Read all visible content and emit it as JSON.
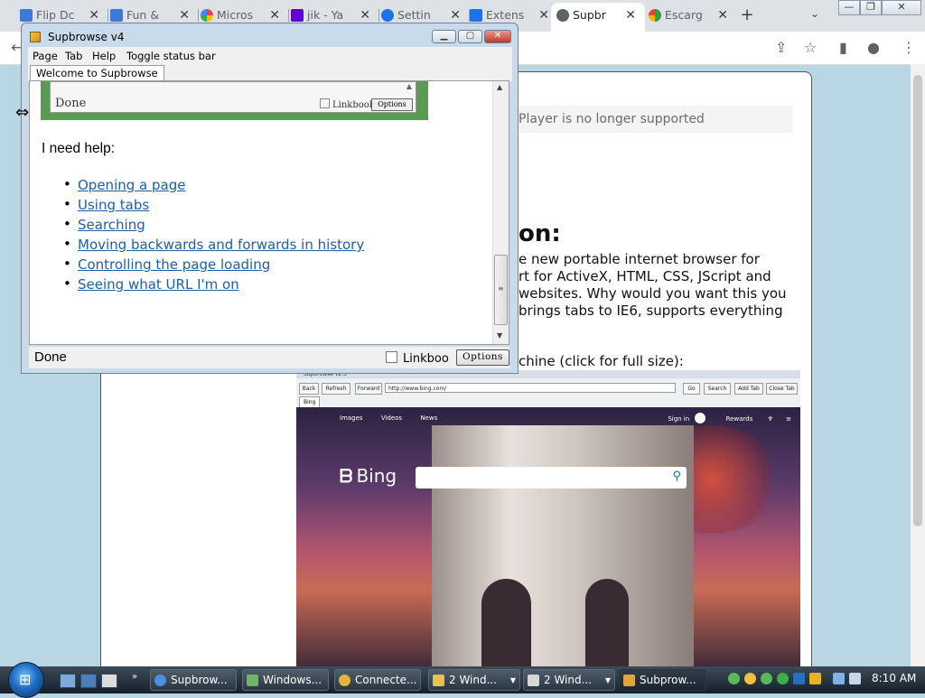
{
  "browser": {
    "tabs": [
      {
        "title": "Flip Dc",
        "favicon": "windows-flag-icon",
        "color": "#3b7bd6",
        "active": false
      },
      {
        "title": "Fun &",
        "favicon": "windows-flag-icon",
        "color": "#3b7bd6",
        "active": false
      },
      {
        "title": "Micros",
        "favicon": "google-icon",
        "color": "#e0553e",
        "active": false
      },
      {
        "title": "jik - Ya",
        "favicon": "yahoo-icon",
        "color": "#5f01d1",
        "active": false
      },
      {
        "title": "Settin",
        "favicon": "gear-icon",
        "color": "#1a73e8",
        "active": false
      },
      {
        "title": "Extens",
        "favicon": "puzzle-icon",
        "color": "#1a73e8",
        "active": false
      },
      {
        "title": "Supbr",
        "favicon": "globe-icon",
        "color": "#5f6368",
        "active": true
      },
      {
        "title": "Escarg",
        "favicon": "escargot-icon",
        "color": "#2e9e44",
        "active": false
      }
    ],
    "new_tab": "+",
    "tab_search": "⌄",
    "window_buttons": {
      "minimize": "—",
      "restore": "❐",
      "close": "✕"
    },
    "toolbar_icons": [
      "share-icon",
      "star-icon",
      "side-panel-icon",
      "profile-icon",
      "menu-icon"
    ]
  },
  "page": {
    "flash_notice": "Player is no longer supported",
    "heading": "on:",
    "paragraph_lines": [
      "e new portable internet browser for",
      "rt for ActiveX, HTML, CSS, JScript and",
      " websites. Why would you want this you",
      " brings tabs to IE6, supports everything"
    ],
    "screenshot_caption": "chine (click for full size):",
    "screenshot": {
      "window_title": "Supbrowse v2.5",
      "buttons": [
        "Back",
        "Refresh",
        "Forward",
        "Go",
        "Search",
        "Add Tab",
        "Close Tab"
      ],
      "url": "http://www.bing.com/",
      "tab": "Bing",
      "bing_nav": [
        "Images",
        "Videos",
        "News"
      ],
      "bing_signin": "Sign in",
      "bing_rewards": "Rewards",
      "bing_logo": "Bing"
    }
  },
  "supbrowse": {
    "title": "Supbrowse v4",
    "menu": [
      "Page",
      "Tab",
      "Help",
      "Toggle status bar"
    ],
    "tab_label": "Welcome to Supbrowse",
    "embedded": {
      "done": "Done",
      "linkbook": "Linkbook",
      "options": "Options"
    },
    "help_heading": "I need help:",
    "help_links": [
      "Opening a page",
      "Using tabs",
      "Searching",
      "Moving backwards and forwards in history",
      "Controlling the page loading",
      "Seeing what URL I'm on"
    ],
    "status": {
      "done": "Done",
      "linkbook": "Linkboo",
      "options": "Options"
    }
  },
  "taskbar": {
    "start": "⊞",
    "tasks": [
      {
        "label": "Supbrow...",
        "icon": "chrome-icon",
        "color": "#4a90e2"
      },
      {
        "label": "Windows...",
        "icon": "windows-explorer-icon",
        "color": "#6fb26a"
      },
      {
        "label": "Connecte...",
        "icon": "connection-icon",
        "color": "#e5b53b"
      },
      {
        "label": "2 Wind...",
        "icon": "folder-icon",
        "color": "#e8c34a"
      },
      {
        "label": "2 Wind...",
        "icon": "notepad-icon",
        "color": "#d8d8d8"
      },
      {
        "label": "Subprow...",
        "icon": "supbrowse-icon",
        "color": "#e0a53a"
      }
    ],
    "clock": "8:10 AM"
  }
}
